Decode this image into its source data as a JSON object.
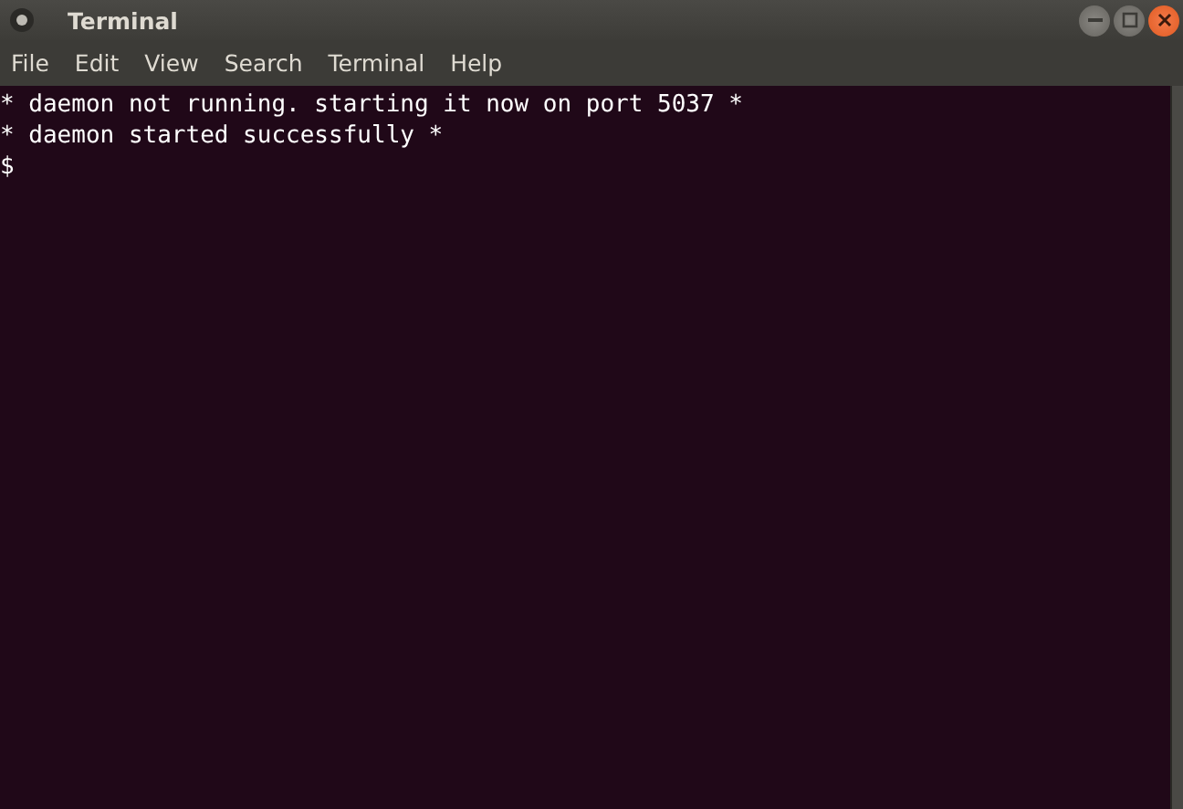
{
  "window": {
    "title": "Terminal"
  },
  "menu": [
    "File",
    "Edit",
    "View",
    "Search",
    "Terminal",
    "Help"
  ],
  "terminal": {
    "lines": [
      "* daemon not running. starting it now on port 5037 *",
      "* daemon started successfully *",
      "$"
    ]
  }
}
